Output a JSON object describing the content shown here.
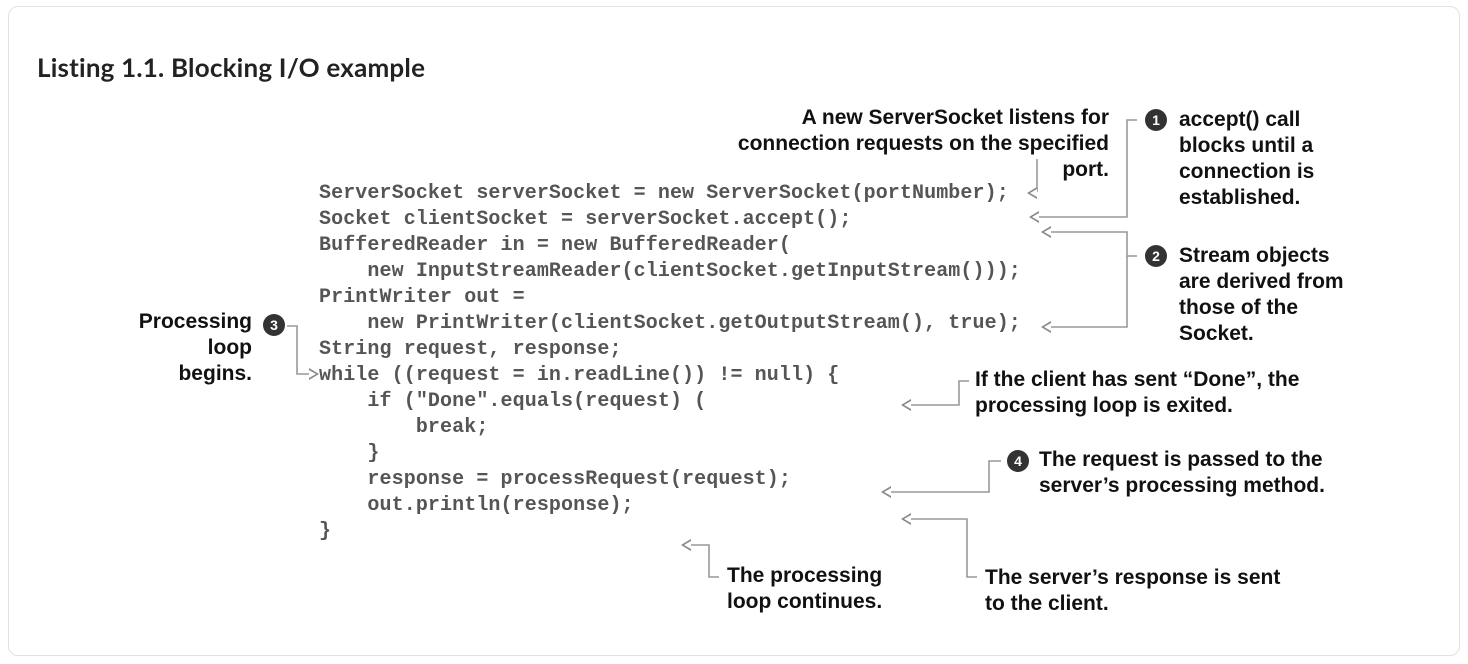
{
  "listing": {
    "title": "Listing 1.1. Blocking I/O example"
  },
  "code": "ServerSocket serverSocket = new ServerSocket(portNumber);\nSocket clientSocket = serverSocket.accept();\nBufferedReader in = new BufferedReader(\n    new InputStreamReader(clientSocket.getInputStream()));\nPrintWriter out =\n    new PrintWriter(clientSocket.getOutputStream(), true);\nString request, response;\nwhile ((request = in.readLine()) != null) {\n    if (\"Done\".equals(request) (\n        break;\n    }\n    response = processRequest(request);\n    out.println(response);\n}",
  "annotations": {
    "top_port": "A new ServerSocket listens for connection requests on the specified port.",
    "marker1": "1",
    "accept": "accept() call blocks until a connection is established.",
    "marker2": "2",
    "streams": "Stream objects are derived from those of the Socket.",
    "marker3": "3",
    "proc_loop_begins": "Processing loop begins.",
    "done": "If the client has sent “Done”, the processing loop is exited.",
    "marker4": "4",
    "request_passed": "The request is passed to the server’s processing method.",
    "loop_continues": "The processing loop continues.",
    "response_sent": "The server’s response is sent to the client."
  }
}
